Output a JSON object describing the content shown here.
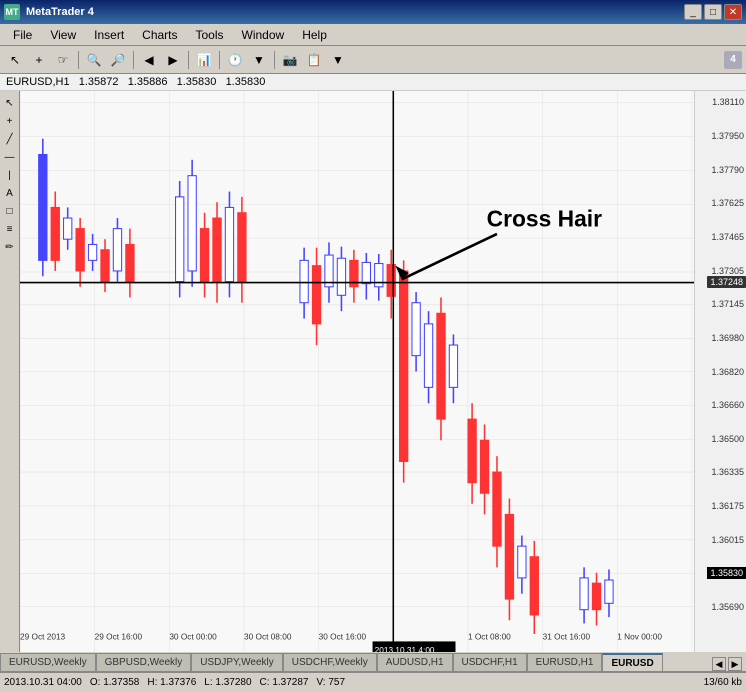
{
  "titleBar": {
    "title": "MetaTrader 4",
    "minimizeLabel": "_",
    "maximizeLabel": "□",
    "closeLabel": "✕"
  },
  "menuBar": {
    "items": [
      "File",
      "View",
      "Insert",
      "Charts",
      "Tools",
      "Window",
      "Help"
    ]
  },
  "toolbar": {
    "number": "4",
    "buttons": [
      "↖",
      "↕",
      "↔",
      "🔍+",
      "🔍-",
      "←",
      "→",
      "📈",
      "📊",
      "🕐",
      "📷",
      "✏"
    ]
  },
  "chart": {
    "symbol": "EURUSD,H1",
    "bid1": "1.35872",
    "bid2": "1.35886",
    "bid3": "1.35830",
    "bid4": "1.35830",
    "crosshairLabel": "Cross Hair",
    "priceLabels": [
      {
        "price": "1.38110",
        "pct": 2
      },
      {
        "price": "1.37950",
        "pct": 8
      },
      {
        "price": "1.37790",
        "pct": 14
      },
      {
        "price": "1.37625",
        "pct": 20
      },
      {
        "price": "1.37465",
        "pct": 26
      },
      {
        "price": "1.37305",
        "pct": 32
      },
      {
        "price": "1.37248",
        "pct": 34,
        "highlighted": true
      },
      {
        "price": "1.37145",
        "pct": 38
      },
      {
        "price": "1.36980",
        "pct": 44
      },
      {
        "price": "1.36820",
        "pct": 50
      },
      {
        "price": "1.36660",
        "pct": 56
      },
      {
        "price": "1.36500",
        "pct": 62
      },
      {
        "price": "1.36335",
        "pct": 68
      },
      {
        "price": "1.36175",
        "pct": 74
      },
      {
        "price": "1.36015",
        "pct": 80
      },
      {
        "price": "1.35830",
        "pct": 86,
        "bottomHighlighted": true
      },
      {
        "price": "1.35690",
        "pct": 92
      }
    ],
    "timeLabels": [
      "29 Oct 2013",
      "29 Oct 16:00",
      "30 Oct 00:00",
      "30 Oct 08:00",
      "30 Oct 16:00",
      "2013.10.31 4:00",
      "1 Oct 08:00",
      "31 Oct 16:00",
      "1 Nov 00:00"
    ],
    "highlightedTime": "2013.10.31 4:00"
  },
  "tabs": [
    {
      "label": "EURUSD,Weekly",
      "active": false
    },
    {
      "label": "GBPUSD,Weekly",
      "active": false
    },
    {
      "label": "USDJPY,Weekly",
      "active": false
    },
    {
      "label": "USDCHF,Weekly",
      "active": false
    },
    {
      "label": "AUDUSD,H1",
      "active": false
    },
    {
      "label": "USDCHF,H1",
      "active": false
    },
    {
      "label": "EURUSD,H1",
      "active": false
    },
    {
      "label": "EURUSD",
      "active": true
    }
  ],
  "statusBar": {
    "datetime": "2013.10.31 04:00",
    "open": "O: 1.37358",
    "high": "H: 1.37376",
    "low": "L: 1.37280",
    "close": "C: 1.37287",
    "volume": "V: 757",
    "filesize": "13/60 kb"
  }
}
